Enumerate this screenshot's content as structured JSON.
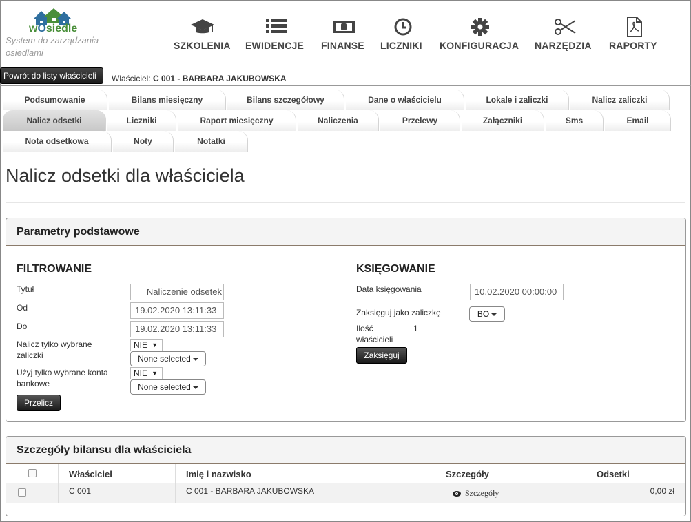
{
  "header": {
    "brand_prefix": "w",
    "brand_o": "O",
    "brand_suffix": "siedle",
    "tagline": "System do zarządzania osiedlami",
    "nav": [
      {
        "label": "SZKOLENIA",
        "icon": "graduation-cap-icon"
      },
      {
        "label": "EWIDENCJE",
        "icon": "list-icon"
      },
      {
        "label": "FINANSE",
        "icon": "money-icon"
      },
      {
        "label": "LICZNIKI",
        "icon": "clock-icon"
      },
      {
        "label": "KONFIGURACJA",
        "icon": "gear-icon"
      },
      {
        "label": "NARZĘDZIA",
        "icon": "scissors-icon"
      },
      {
        "label": "RAPORTY",
        "icon": "pdf-icon"
      }
    ]
  },
  "owner_bar": {
    "back_label": "Powrót do listy właścicieli",
    "owner_prefix": "Właściciel:",
    "owner_value": "C 001 - BARBARA JAKUBOWSKA"
  },
  "tabs": {
    "row1": [
      "Podsumowanie",
      "Bilans miesięczny",
      "Bilans szczegółowy",
      "Dane o właścicielu",
      "Lokale i zaliczki",
      "Nalicz zaliczki"
    ],
    "row2": [
      "Nalicz odsetki",
      "Liczniki",
      "Raport miesięczny",
      "Naliczenia",
      "Przelewy",
      "Załączniki",
      "Sms",
      "Email"
    ],
    "row3": [
      "Nota odsetkowa",
      "Noty",
      "Notatki"
    ],
    "active": "Nalicz odsetki"
  },
  "page_title": "Nalicz odsetki dla właściciela",
  "params": {
    "heading": "Parametry podstawowe",
    "filter": {
      "title": "FILTROWANIE",
      "tytul_label": "Tytuł",
      "tytul_value": "Naliczenie odsetek",
      "od_label": "Od",
      "od_value": "19.02.2020 13:11:33",
      "do_label": "Do",
      "do_value": "19.02.2020 13:11:33",
      "zaliczki_label": "Nalicz tylko wybrane zaliczki",
      "zaliczki_select": "NIE",
      "zaliczki_dd": "None selected",
      "konta_label": "Użyj tylko wybrane konta bankowe",
      "konta_select": "NIE",
      "konta_dd": "None selected",
      "recalc_button": "Przelicz"
    },
    "booking": {
      "title": "KSIĘGOWANIE",
      "date_label": "Data księgowania",
      "date_value": "10.02.2020 00:00:00",
      "as_label": "Zaksięguj jako zaliczkę",
      "as_value": "BO",
      "count_label": "Ilość właścicieli",
      "count_value": "1",
      "post_button": "Zaksięguj"
    }
  },
  "details": {
    "heading": "Szczegóły bilansu dla właściciela",
    "columns": [
      "Właściciel",
      "Imię i nazwisko",
      "Szczegóły",
      "Odsetki"
    ],
    "rows": [
      {
        "owner": "C 001",
        "name": "C 001 - BARBARA JAKUBOWSKA",
        "details": "Szczegóły",
        "interest": "0,00 zł"
      }
    ]
  }
}
